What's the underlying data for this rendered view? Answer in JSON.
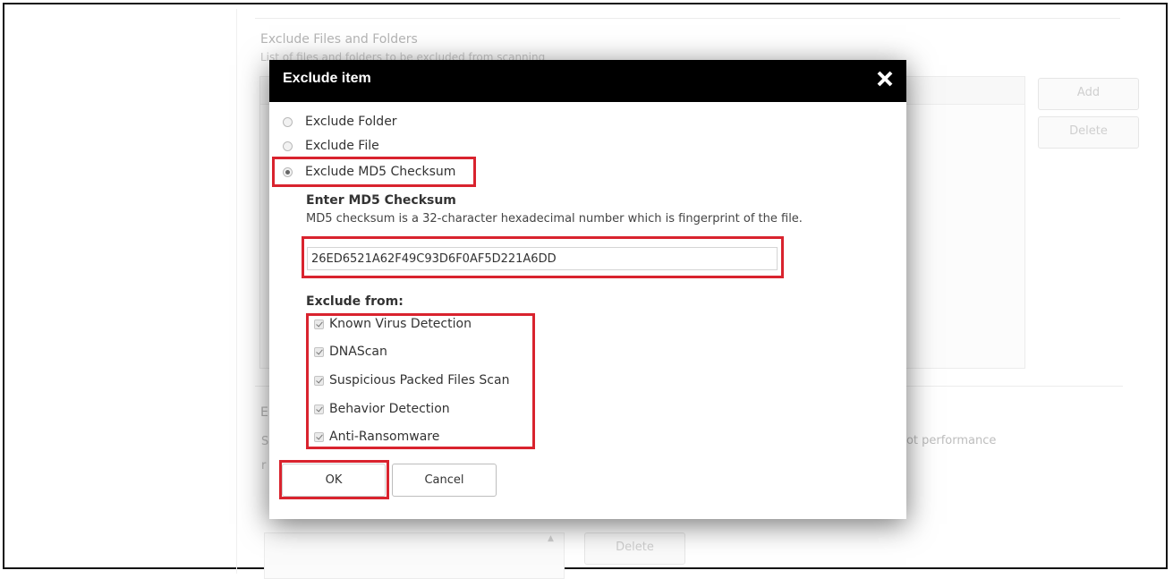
{
  "background": {
    "section_title": "Exclude Files and Folders",
    "section_desc": "List of files and folders to be excluded from scanning",
    "add_label": "Add",
    "delete_label": "Delete",
    "section2_title": "E",
    "section2_desc": "oot performance",
    "left_frag1": "S",
    "left_frag2": "r",
    "delete2_label": "Delete"
  },
  "dialog": {
    "title": "Exclude item",
    "close_icon": "close-icon",
    "options": [
      {
        "label": "Exclude Folder",
        "selected": false
      },
      {
        "label": "Exclude File",
        "selected": false
      },
      {
        "label": "Exclude MD5 Checksum",
        "selected": true
      }
    ],
    "md5_label": "Enter MD5 Checksum",
    "md5_desc": "MD5 checksum is a 32-character hexadecimal number which is fingerprint of the file.",
    "md5_value": "26ED6521A62F49C93D6F0AF5D221A6DD",
    "exclude_from_label": "Exclude from:",
    "exclude_from": [
      {
        "label": "Known Virus Detection",
        "checked": true
      },
      {
        "label": "DNAScan",
        "checked": true
      },
      {
        "label": "Suspicious Packed Files Scan",
        "checked": true
      },
      {
        "label": "Behavior Detection",
        "checked": true
      },
      {
        "label": "Anti-Ransomware",
        "checked": true
      }
    ],
    "ok_label": "OK",
    "cancel_label": "Cancel"
  },
  "colors": {
    "highlight": "#d9232e",
    "header_bg": "#000000"
  }
}
